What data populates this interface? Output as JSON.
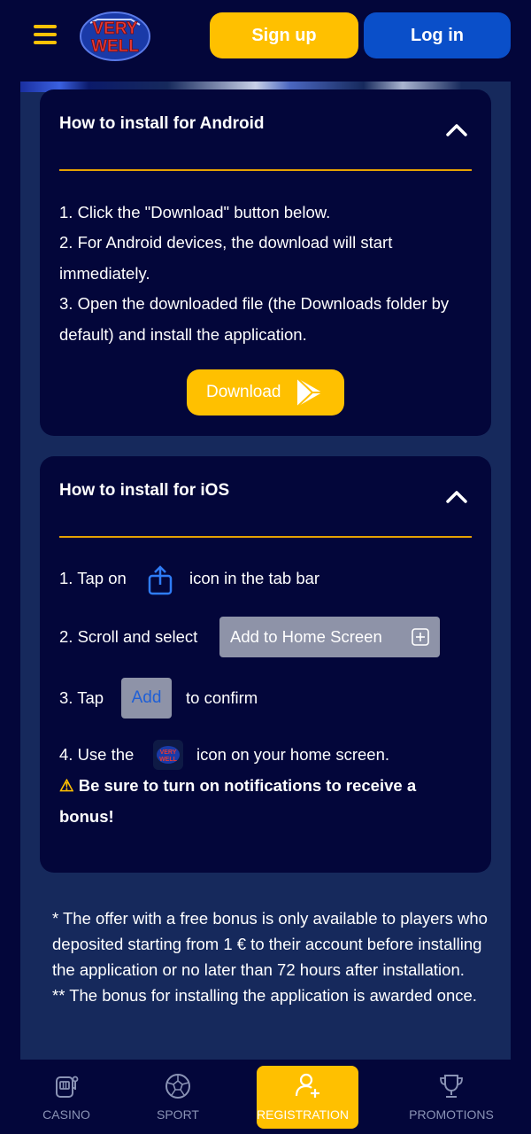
{
  "header": {
    "signup_label": "Sign up",
    "login_label": "Log in",
    "logo_alt": "VERY WELL"
  },
  "android": {
    "title": "How to install for Android",
    "steps": [
      "1. Click the \"Download\" button below.",
      "2. For Android devices, the download will start immediately.",
      "3. Open the downloaded file (the Downloads folder by default) and install the application."
    ],
    "download_label": "Download"
  },
  "ios": {
    "title": "How to install for iOS",
    "step1_prefix": "1. Tap on",
    "step1_suffix": "icon in the tab bar",
    "step2_prefix": "2. Scroll and select",
    "add_home_screen_label": "Add to Home Screen",
    "step3_prefix": "3. Tap",
    "add_label": "Add",
    "step3_suffix": "to confirm",
    "step4_prefix": "4. Use the",
    "step4_suffix": "icon on your home screen.",
    "warning_symbol": "⚠",
    "warning_text": "Be sure to turn on notifications to receive a bonus!"
  },
  "footnotes": {
    "line1": "* The offer with a free bonus is only available to players who deposited starting from 1 € to their account before installing the application or no later than 72 hours after installation.",
    "line2": "** The bonus for installing the application is awarded once."
  },
  "bottom_nav": {
    "items": [
      {
        "label": "CASINO",
        "icon": "slot-machine-icon"
      },
      {
        "label": "SPORT",
        "icon": "soccer-ball-icon"
      },
      {
        "label": "REGISTRATION",
        "icon": "user-plus-icon"
      },
      {
        "label": "PROMOTIONS",
        "icon": "trophy-icon"
      }
    ],
    "active_index": 2
  },
  "colors": {
    "background": "#03063a",
    "panel": "#16295c",
    "accent_yellow": "#ffc000",
    "accent_blue": "#0a4fc9",
    "divider": "#e5a200"
  }
}
